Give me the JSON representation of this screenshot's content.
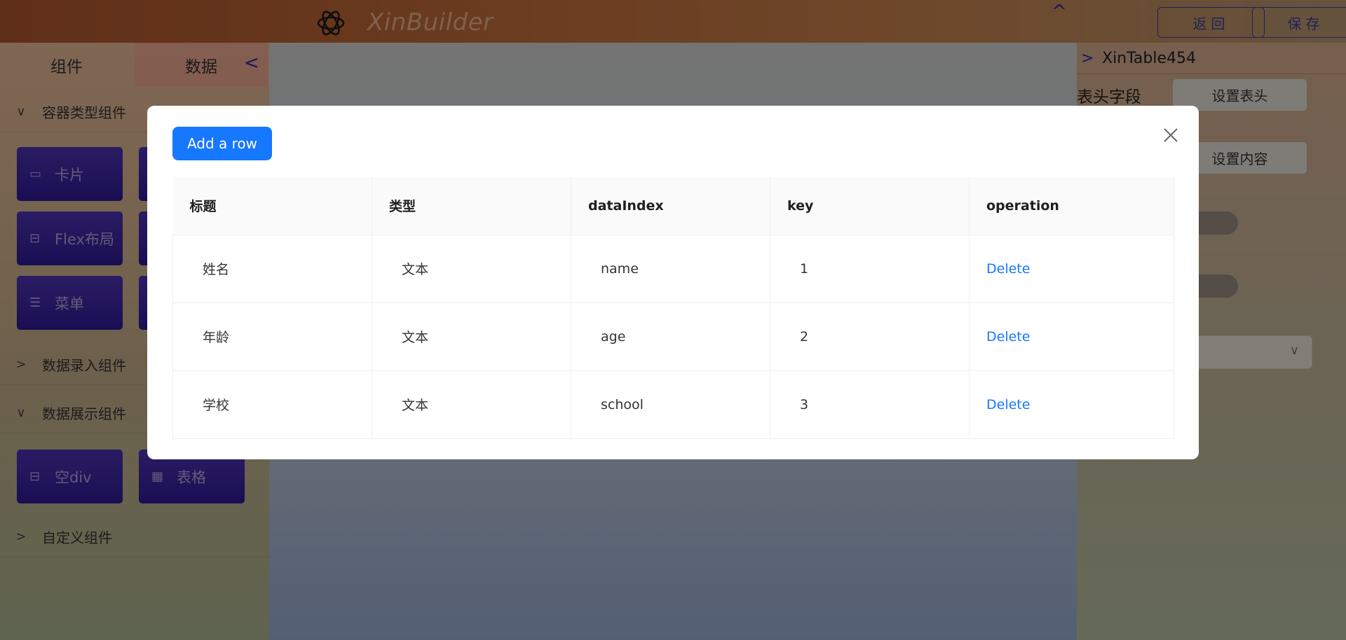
{
  "header": {
    "brand": "XinBuilder",
    "back_label": "返回",
    "save_label": "保存"
  },
  "left_panel": {
    "tabs": [
      "组件",
      "数据"
    ],
    "groups": [
      {
        "label": "容器类型组件",
        "expanded": true,
        "items": [
          {
            "label": "卡片",
            "icon": "card-icon"
          },
          {
            "label": "Flex布局",
            "icon": "flex-layout-icon"
          },
          {
            "label": "菜单",
            "icon": "menu-icon"
          }
        ]
      },
      {
        "label": "数据录入组件",
        "expanded": false,
        "items": []
      },
      {
        "label": "数据展示组件",
        "expanded": true,
        "items": [
          {
            "label": "空div",
            "icon": "empty-div-icon"
          },
          {
            "label": "表格",
            "icon": "table-icon"
          }
        ]
      },
      {
        "label": "自定义组件",
        "expanded": false,
        "items": []
      }
    ]
  },
  "right_panel": {
    "component_name": "XinTable454",
    "header_field_label": "表头字段",
    "set_header_label": "设置表头",
    "set_content_label": "设置内容"
  },
  "modal": {
    "add_row_label": "Add a row",
    "columns": [
      "标题",
      "类型",
      "dataIndex",
      "key",
      "operation"
    ],
    "rows": [
      {
        "title": "姓名",
        "type": "文本",
        "dataIndex": "name",
        "key": "1",
        "operation": "Delete"
      },
      {
        "title": "年龄",
        "type": "文本",
        "dataIndex": "age",
        "key": "2",
        "operation": "Delete"
      },
      {
        "title": "学校",
        "type": "文本",
        "dataIndex": "school",
        "key": "3",
        "operation": "Delete"
      }
    ]
  },
  "colors": {
    "primary": "#1677ff",
    "component_tile": "#3a22a8",
    "accent_nav": "#2a2aa8"
  }
}
